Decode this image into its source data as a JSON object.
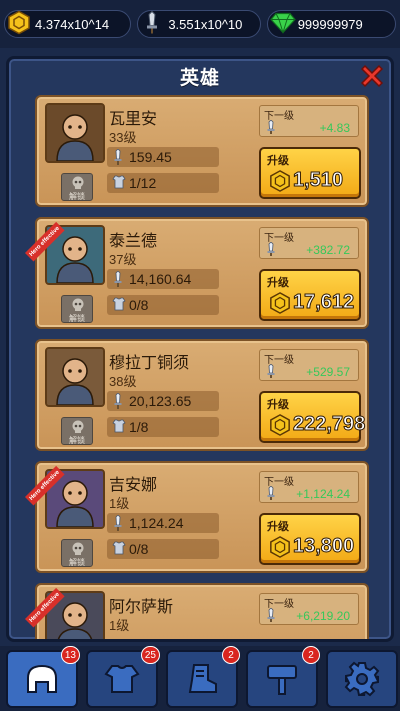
{
  "resources": {
    "gold": "4.374x10^14",
    "dps": "3.551x10^10",
    "gems": "999999979"
  },
  "panel": {
    "title": "英雄"
  },
  "labels": {
    "next_level": "下一级",
    "upgrade": "升级",
    "unlock": "解锁",
    "ribbon": "Hero effective"
  },
  "heroes": [
    {
      "name": "瓦里安",
      "level": "33级",
      "dps": "159.45",
      "gear": "1/12",
      "next_gain": "+4.83",
      "cost": "1,510",
      "ribbon": false
    },
    {
      "name": "泰兰德",
      "level": "37级",
      "dps": "14,160.64",
      "gear": "0/8",
      "next_gain": "+382.72",
      "cost": "17,612",
      "ribbon": true
    },
    {
      "name": "穆拉丁铜须",
      "level": "38级",
      "dps": "20,123.65",
      "gear": "1/8",
      "next_gain": "+529.57",
      "cost": "222,798",
      "ribbon": false
    },
    {
      "name": "吉安娜",
      "level": "1级",
      "dps": "1,124.24",
      "gear": "0/8",
      "next_gain": "+1,124.24",
      "cost": "13,800",
      "ribbon": true
    },
    {
      "name": "阿尔萨斯",
      "level": "1级",
      "dps": "",
      "gear": "",
      "next_gain": "+6,219.20",
      "cost": "",
      "ribbon": true
    }
  ],
  "tabs": [
    {
      "name": "heroes",
      "icon": "helmet-icon",
      "badge": "13"
    },
    {
      "name": "equipment",
      "icon": "armor-icon",
      "badge": "25"
    },
    {
      "name": "skills",
      "icon": "boot-icon",
      "badge": "2"
    },
    {
      "name": "artifacts",
      "icon": "hammer-icon",
      "badge": "2"
    },
    {
      "name": "settings",
      "icon": "gear-icon",
      "badge": ""
    }
  ],
  "colors": {
    "gain": "#36c85a",
    "upgrade_button": "#ffc52a",
    "badge": "#d9261f"
  }
}
